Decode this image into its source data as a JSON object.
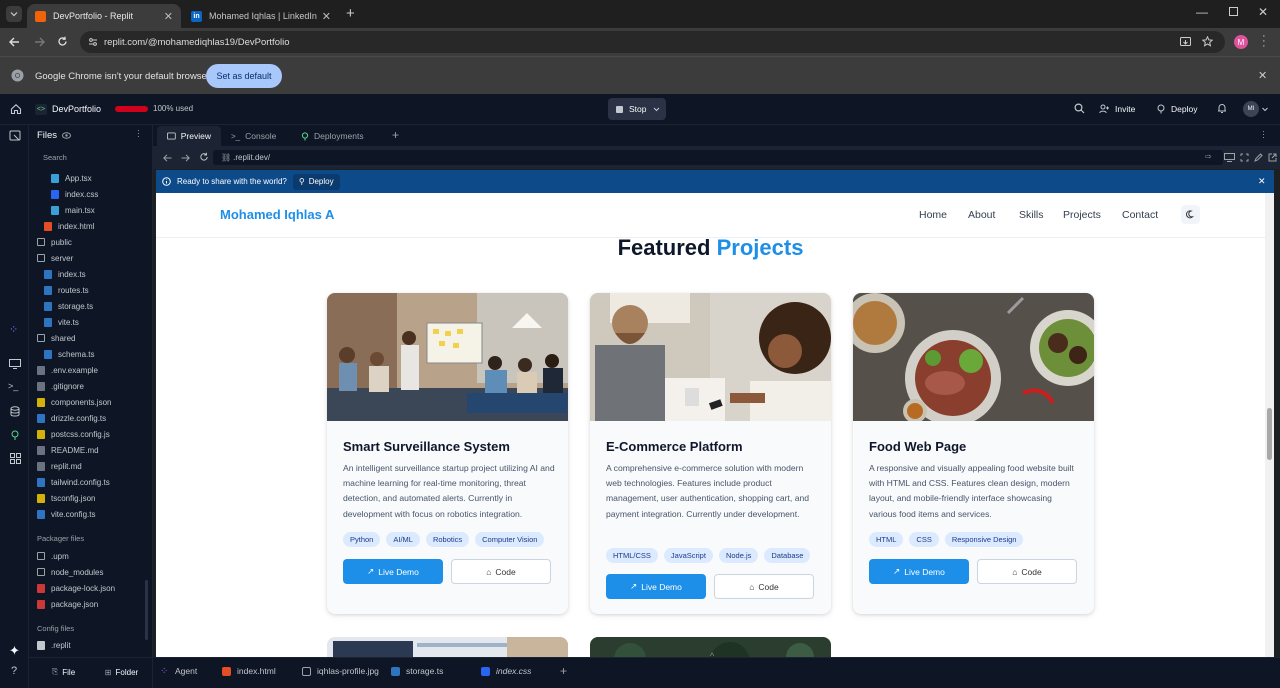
{
  "browser": {
    "tabs": [
      {
        "title": "DevPortfolio - Replit",
        "active": true
      },
      {
        "title": "Mohamed Iqhlas | LinkedIn",
        "active": false
      }
    ],
    "url": "replit.com/@mohamediqhlas19/DevPortfolio",
    "infobar_message": "Google Chrome isn't your default browser",
    "infobar_button": "Set as default",
    "profile_initial": "M"
  },
  "replit": {
    "project_name": "DevPortfolio",
    "usage_label": "100% used",
    "usage_fraction": 1.0,
    "stop_label": "Stop",
    "invite_label": "Invite",
    "deploy_label": "Deploy",
    "avatar": "MI",
    "files_title": "Files",
    "search_label": "Search",
    "file_tree": [
      {
        "name": "App.tsx",
        "type": "tsx",
        "level": 2
      },
      {
        "name": "index.css",
        "type": "css",
        "level": 2
      },
      {
        "name": "main.tsx",
        "type": "tsx",
        "level": 2
      },
      {
        "name": "index.html",
        "type": "html",
        "level": 1
      },
      {
        "name": "public",
        "type": "folder",
        "level": 0
      },
      {
        "name": "server",
        "type": "folder-open",
        "level": 0
      },
      {
        "name": "index.ts",
        "type": "ts",
        "level": 1
      },
      {
        "name": "routes.ts",
        "type": "ts",
        "level": 1
      },
      {
        "name": "storage.ts",
        "type": "ts",
        "level": 1
      },
      {
        "name": "vite.ts",
        "type": "ts",
        "level": 1
      },
      {
        "name": "shared",
        "type": "folder-open",
        "level": 0
      },
      {
        "name": "schema.ts",
        "type": "ts",
        "level": 1
      },
      {
        "name": ".env.example",
        "type": "file",
        "level": 0
      },
      {
        "name": ".gitignore",
        "type": "file",
        "level": 0
      },
      {
        "name": "components.json",
        "type": "json",
        "level": 0
      },
      {
        "name": "drizzle.config.ts",
        "type": "ts",
        "level": 0
      },
      {
        "name": "postcss.config.js",
        "type": "js",
        "level": 0
      },
      {
        "name": "README.md",
        "type": "md",
        "level": 0
      },
      {
        "name": "replit.md",
        "type": "md",
        "level": 0
      },
      {
        "name": "tailwind.config.ts",
        "type": "ts",
        "level": 0
      },
      {
        "name": "tsconfig.json",
        "type": "json",
        "level": 0
      },
      {
        "name": "vite.config.ts",
        "type": "ts",
        "level": 0
      }
    ],
    "packager_title": "Packager files",
    "packager_files": [
      {
        "name": ".upm",
        "type": "folder"
      },
      {
        "name": "node_modules",
        "type": "folder"
      },
      {
        "name": "package-lock.json",
        "type": "npm"
      },
      {
        "name": "package.json",
        "type": "npm"
      }
    ],
    "config_title": "Config files",
    "config_files": [
      {
        "name": ".replit",
        "type": "replit"
      }
    ],
    "file_button": "File",
    "folder_button": "Folder",
    "pane_tabs": [
      "Preview",
      "Console",
      "Deployments"
    ],
    "preview_url": ".replit.dev/",
    "deploy_bar_message": "Ready to share with the world?",
    "deploy_bar_button": "Deploy",
    "bottom_tabs": [
      "Agent",
      "index.html",
      "iqhlas-profile.jpg",
      "storage.ts",
      "index.css"
    ]
  },
  "site": {
    "brand": "Mohamed Iqhlas A",
    "nav": [
      "Home",
      "About",
      "Skills",
      "Projects",
      "Contact"
    ],
    "heading_part1": "Featured",
    "heading_part2": "Projects",
    "projects": [
      {
        "title": "Smart Surveillance System",
        "desc": "An intelligent surveillance startup project utilizing AI and machine learning for real-time monitoring, threat detection, and automated alerts. Currently in development with focus on robotics integration.",
        "tags": [
          "Python",
          "AI/ML",
          "Robotics",
          "Computer Vision"
        ],
        "demo": "Live Demo",
        "code": "Code"
      },
      {
        "title": "E-Commerce Platform",
        "desc": "A comprehensive e-commerce solution with modern web technologies. Features include product management, user authentication, shopping cart, and payment integration. Currently under development.",
        "tags": [
          "HTML/CSS",
          "JavaScript",
          "Node.js",
          "Database"
        ],
        "demo": "Live Demo",
        "code": "Code"
      },
      {
        "title": "Food Web Page",
        "desc": "A responsive and visually appealing food website built with HTML and CSS. Features clean design, modern layout, and mobile-friendly interface showcasing various food items and services.",
        "tags": [
          "HTML",
          "CSS",
          "Responsive Design"
        ],
        "demo": "Live Demo",
        "code": "Code"
      }
    ]
  },
  "colors": {
    "accent": "#1e8fe8",
    "replit_bg": "#0e1525",
    "deploy_bar": "#0d4a8a"
  }
}
